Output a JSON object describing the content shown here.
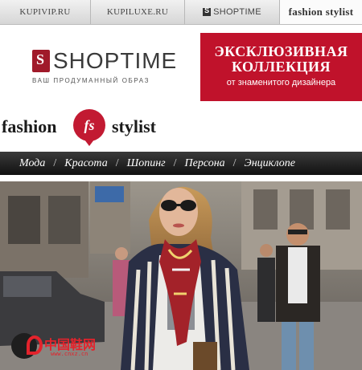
{
  "tabs": [
    {
      "label": "KUPIVIP.RU",
      "active": false
    },
    {
      "label": "KUPILUXE.RU",
      "active": false
    },
    {
      "label": "SHOPTIME",
      "active": false
    },
    {
      "label": "fashion stylist",
      "active": true
    }
  ],
  "shoptime": {
    "logo_text": "SHOPTIME",
    "tagline": "ВАШ ПРОДУМАННЫЙ ОБРАЗ"
  },
  "banner": {
    "title": "ЭКСКЛЮЗИВНАЯ КОЛЛЕКЦИЯ",
    "subtitle": "от знаменитого дизайнера",
    "color": "#c0122b"
  },
  "brand": {
    "word1": "fashion",
    "badge": "fs",
    "word2": "stylist",
    "accent": "#c21a32"
  },
  "nav": {
    "items": [
      "Мода",
      "Красота",
      "Шопинг",
      "Персона",
      "Энциклопе"
    ],
    "separator": "/"
  },
  "watermark": {
    "name": "中国鞋网",
    "url": "www.cnxz.cn"
  }
}
